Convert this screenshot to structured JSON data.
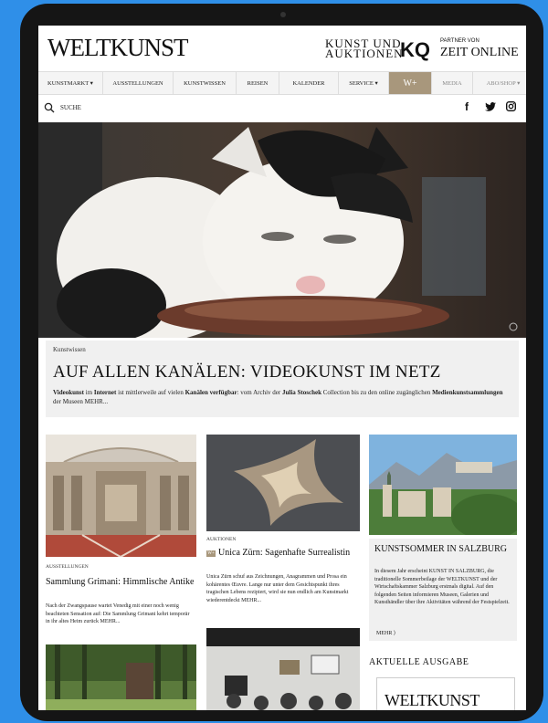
{
  "header": {
    "logo": "WELTKUNST",
    "kua_line1": "KUNST UND",
    "kua_line2": "AUKTIONEN",
    "kq": "KQ",
    "partner": "PARTNER VON",
    "zeit": "ZEIT ONLINE"
  },
  "nav": {
    "items": [
      {
        "label": "KUNSTMARKT ▾"
      },
      {
        "label": "AUSSTELLUNGEN"
      },
      {
        "label": "KUNSTWISSEN"
      },
      {
        "label": "REISEN"
      },
      {
        "label": "KALENDER"
      },
      {
        "label": "SERVICE ▾"
      },
      {
        "label": "W+"
      },
      {
        "label": "MEDIA"
      },
      {
        "label": "ABO/SHOP ▾"
      }
    ]
  },
  "search": {
    "label": "SUCHE"
  },
  "social": {
    "facebook": "f",
    "twitter": "🐦",
    "instagram": "◎"
  },
  "feature": {
    "kicker": "Kunstwissen",
    "headline": "AUF ALLEN KANÄLEN: VIDEOKUNST IM NETZ",
    "teaser_b1": "Videokunst",
    "teaser_1": " im ",
    "teaser_b2": "Internet",
    "teaser_2": " ist mittlerweile auf vielen ",
    "teaser_b3": "Kanälen verfügbar",
    "teaser_3": ": vom Archiv der ",
    "teaser_b4": "Julia Stoschek",
    "teaser_4": " Collection bis zu den online zugänglichen ",
    "teaser_b5": "Medienkunstsammlungen",
    "teaser_5": " der Museen  ",
    "more": "MEHR..."
  },
  "cards": [
    {
      "kicker": "AUSSTELLUNGEN",
      "title": "Sammlung Grimani: Himmlische Antike",
      "text": "Nach der Zwangspause wartet Venedig mit einer noch wenig beachteten Sensation auf: Die Sammlung Grimani kehrt temporär in ihr altes Heim zurück MEHR..."
    },
    {
      "kicker": "AUKTIONEN",
      "badge": "W+",
      "title": "Unica Zürn: Sagenhafte Surrealistin",
      "text": "Unica Zürn schuf aus Zeichnungen, Anagrammen und Prosa ein kohärentes Œuvre. Lange nur unter dem Gesichtspunkt ihres tragischen Lebens rezipiert, wird sie nun endlich am Kunstmarkt wiederentdeckt MEHR..."
    },
    {
      "title": "KUNSTSOMMER IN SALZBURG",
      "text": "In diesem Jahr erscheint KUNST IN SALZBURG, die traditionelle Sommerbeilage der WELTKUNST und der Wirtschaftskammer Salzburg erstmals digital. Auf den folgenden Seiten informieren Museen, Galerien und Kunsthändler über ihre Aktivitäten während der Festspielzeit.",
      "more": "MEHR ⟩"
    }
  ],
  "sidebar": {
    "aktuell": "AKTUELLE AUSGABE",
    "mag_title": "WELTKUNST"
  }
}
